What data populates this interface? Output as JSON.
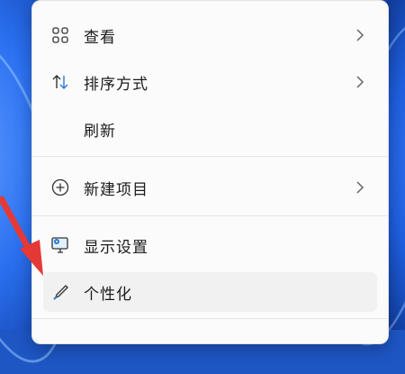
{
  "context_menu": {
    "items": [
      {
        "label": "查看",
        "icon": "view-grid-icon",
        "has_submenu": true
      },
      {
        "label": "排序方式",
        "icon": "sort-icon",
        "has_submenu": true
      },
      {
        "label": "刷新",
        "icon": "",
        "has_submenu": false
      },
      {
        "label": "新建项目",
        "icon": "new-item-plus-icon",
        "has_submenu": true
      },
      {
        "label": "显示设置",
        "icon": "display-settings-icon",
        "has_submenu": false
      },
      {
        "label": "个性化",
        "icon": "personalize-brush-icon",
        "has_submenu": false
      }
    ]
  },
  "annotation": {
    "color": "#e53935",
    "icon": "red-pointer-arrow"
  },
  "colors": {
    "accent": "#2b78d6",
    "menu_bg": "#fbfbfb"
  }
}
